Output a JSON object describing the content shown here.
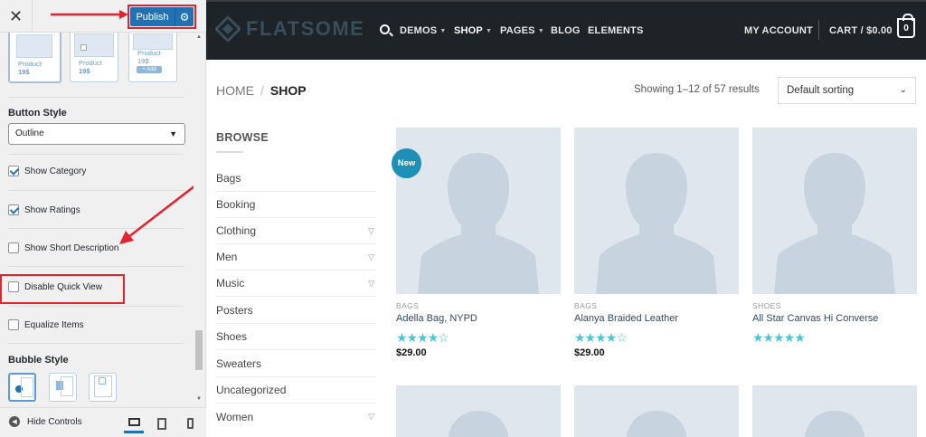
{
  "customizer": {
    "close_glyph": "✕",
    "publish_label": "Publish",
    "product_cards": [
      {
        "label": "Product",
        "price": "19$"
      },
      {
        "label": "Product",
        "price": "19$"
      },
      {
        "label": "Product",
        "price": "19$",
        "add": "+ Add"
      }
    ],
    "button_style_title": "Button Style",
    "button_style_value": "Outline",
    "checkboxes": [
      {
        "label": "Show Category",
        "checked": true
      },
      {
        "label": "Show Ratings",
        "checked": true
      },
      {
        "label": "Show Short Description",
        "checked": false
      },
      {
        "label": "Disable Quick View",
        "checked": false
      },
      {
        "label": "Equalize Items",
        "checked": false
      }
    ],
    "bubble_style_title": "Bubble Style",
    "hide_controls_label": "Hide Controls",
    "accent_color": "#2271b1",
    "highlight_color": "#e3232d"
  },
  "header": {
    "logo_text": "FLATSOME",
    "nav": [
      {
        "label": "DEMOS",
        "dropdown": true
      },
      {
        "label": "SHOP",
        "dropdown": true,
        "active": true
      },
      {
        "label": "PAGES",
        "dropdown": true
      },
      {
        "label": "BLOG",
        "dropdown": false
      },
      {
        "label": "ELEMENTS",
        "dropdown": false
      }
    ],
    "account_label": "MY ACCOUNT",
    "cart_label": "CART / $0.00",
    "cart_count": "0"
  },
  "shop": {
    "breadcrumb": {
      "home": "HOME",
      "separator": "/",
      "current": "SHOP"
    },
    "result_count": "Showing 1–12 of 57 results",
    "sorting_value": "Default sorting",
    "browse_title": "BROWSE",
    "categories": [
      {
        "label": "Bags",
        "expandable": false
      },
      {
        "label": "Booking",
        "expandable": false
      },
      {
        "label": "Clothing",
        "expandable": true
      },
      {
        "label": "Men",
        "expandable": true
      },
      {
        "label": "Music",
        "expandable": true
      },
      {
        "label": "Posters",
        "expandable": false
      },
      {
        "label": "Shoes",
        "expandable": false
      },
      {
        "label": "Sweaters",
        "expandable": false
      },
      {
        "label": "Uncategorized",
        "expandable": false
      },
      {
        "label": "Women",
        "expandable": true
      }
    ],
    "new_badge": "New",
    "products": [
      {
        "category": "BAGS",
        "name": "Adella Bag, NYPD",
        "rating": 4,
        "stars": "★★★★☆",
        "price": "$29.00"
      },
      {
        "category": "BAGS",
        "name": "Alanya Braided Leather",
        "rating": 4,
        "stars": "★★★★☆",
        "price": "$29.00"
      },
      {
        "category": "SHOES",
        "name": "All Star Canvas Hi Converse",
        "rating": 4.5,
        "stars": "★★★★★"
      }
    ]
  }
}
